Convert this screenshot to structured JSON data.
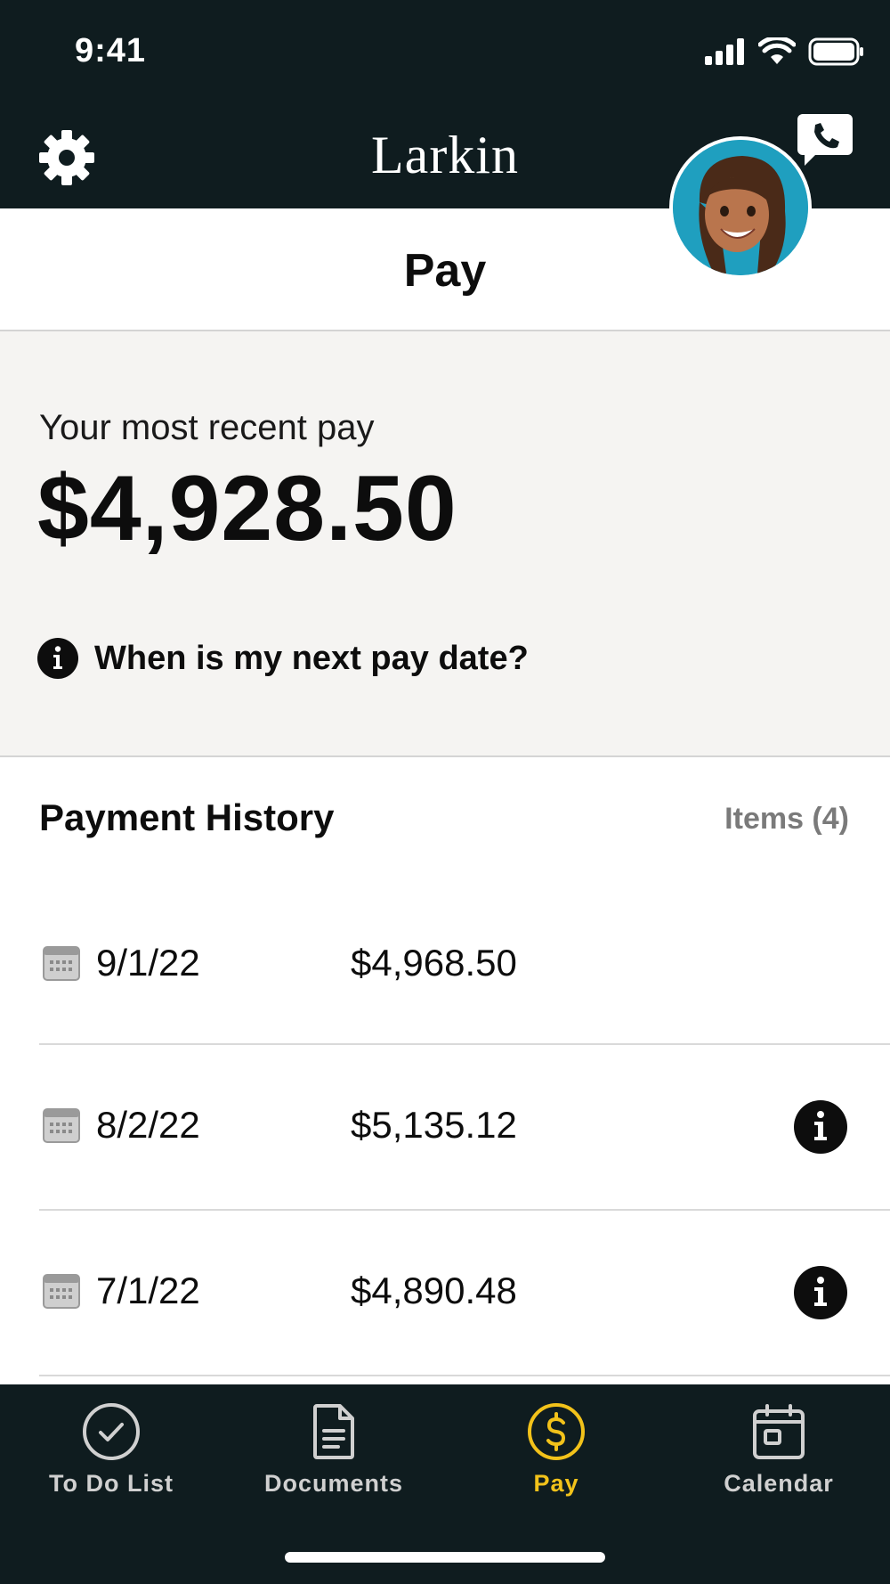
{
  "status_bar": {
    "time": "9:41"
  },
  "header": {
    "brand": "Larkin"
  },
  "page": {
    "title": "Pay"
  },
  "recent_pay": {
    "label": "Your most recent pay",
    "amount": "$4,928.50",
    "next_pay_link": "When is my next pay date?"
  },
  "history": {
    "title": "Payment History",
    "count": "Items (4)",
    "rows": [
      {
        "date": "9/1/22",
        "amount": "$4,968.50"
      },
      {
        "date": "8/2/22",
        "amount": "$5,135.12"
      },
      {
        "date": "7/1/22",
        "amount": "$4,890.48"
      }
    ]
  },
  "tabs": [
    {
      "label": "To Do List",
      "icon": "check-circle-icon"
    },
    {
      "label": "Documents",
      "icon": "document-icon"
    },
    {
      "label": "Pay",
      "icon": "dollar-circle-icon"
    },
    {
      "label": "Calendar",
      "icon": "calendar-icon"
    }
  ],
  "colors": {
    "dark": "#0f1c1f",
    "accent": "#f2c21a",
    "panel": "#f5f4f2",
    "avatar_bg": "#1f9fbf"
  }
}
